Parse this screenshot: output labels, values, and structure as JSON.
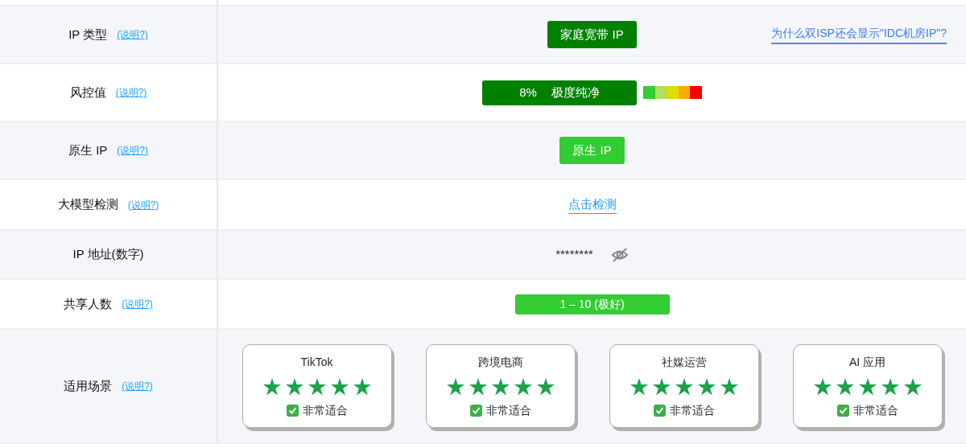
{
  "rows": [
    {
      "label": "IP 类型",
      "help": "(说明?)",
      "kind": "badge",
      "value": "家庭宽带 IP",
      "color": "#008000",
      "link": "为什么双ISP还会显示\"IDC机房IP\"?"
    },
    {
      "label": "风控值",
      "help": "(说明?)",
      "kind": "risk",
      "percent": "8%",
      "value": "极度纯净",
      "color": "#008000",
      "scale": [
        {
          "color": "#33cc33"
        },
        {
          "color": "#b3dd5a"
        },
        {
          "color": "#dddd00"
        },
        {
          "color": "#ffaa00"
        },
        {
          "color": "#ff0000"
        }
      ]
    },
    {
      "label": "原生 IP",
      "help": "(说明?)",
      "kind": "badge",
      "value": "原生 IP",
      "color": "#33cc33"
    },
    {
      "label": "大模型检测",
      "help": "(说明?)",
      "kind": "link",
      "value": "点击检测"
    },
    {
      "label": "IP 地址(数字)",
      "kind": "masked",
      "value": "********"
    },
    {
      "label": "共享人数",
      "help": "(说明?)",
      "kind": "wide-badge",
      "value": "1 – 10 (极好)",
      "color": "#33cc33"
    },
    {
      "label": "适用场景",
      "help": "(说明?)",
      "kind": "scenarios",
      "cards": [
        {
          "name": "TikTok",
          "stars": 5,
          "verdict": "非常适合"
        },
        {
          "name": "跨境电商",
          "stars": 5,
          "verdict": "非常适合"
        },
        {
          "name": "社媒运营",
          "stars": 5,
          "verdict": "非常适合"
        },
        {
          "name": "AI 应用",
          "stars": 5,
          "verdict": "非常适合"
        }
      ]
    }
  ]
}
